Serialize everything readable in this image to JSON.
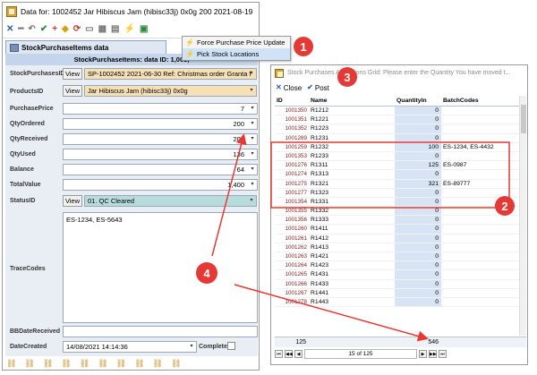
{
  "left_window": {
    "title": "Data for: 1002452 Jar Hibiscus Jam  (hibisc33j) 0x0g 200 2021-08-19",
    "tab_label": "StockPurchaseItems data",
    "form_header": "StockPurchaseItems: data ID: 1,003,",
    "fields": {
      "stock_purchases_id": {
        "label": "StockPurchasesID",
        "view": "View",
        "value": "SP-1002452 2021-06-30 Ref: Christmas order Granta f"
      },
      "products_id": {
        "label": "ProductsID",
        "view": "View",
        "value": "Jar Hibiscus Jam  (hibisc33j) 0x0g"
      },
      "purchase_price": {
        "label": "PurchasePrice",
        "value": "7"
      },
      "qty_ordered": {
        "label": "QtyOrdered",
        "value": "200"
      },
      "qty_received": {
        "label": "QtyReceived",
        "value": "200"
      },
      "qty_used": {
        "label": "QtyUsed",
        "value": "136"
      },
      "balance": {
        "label": "Balance",
        "value": "64"
      },
      "total_value": {
        "label": "TotalValue",
        "value": "1,400"
      },
      "status_id": {
        "label": "StatusID",
        "view": "View",
        "value": "01. QC Cleared"
      },
      "trace_codes": {
        "label": "TraceCodes",
        "value": "ES-1234, ES-5643"
      },
      "bb_date_received": {
        "label": "BBDateReceived",
        "value": ""
      },
      "date_created": {
        "label": "DateCreated",
        "value": "14/08/2021 14:14:36"
      },
      "complete": {
        "label": "Complete"
      }
    }
  },
  "popup_menu": {
    "items": [
      {
        "label": "Force Purchase Price Update"
      },
      {
        "label": "Pick Stock Locations"
      }
    ]
  },
  "right_window": {
    "title": "Stock Purchases Allocations  Grid: Please enter the Quantity You have moved t...",
    "close_label": "Close",
    "post_label": "Post",
    "columns": [
      "ID",
      "Name",
      "QuantityIn",
      "BatchCodes"
    ],
    "rows": [
      {
        "id": "1001350",
        "name": "R1212",
        "qty": "0",
        "batch": ""
      },
      {
        "id": "1001351",
        "name": "R1221",
        "qty": "0",
        "batch": ""
      },
      {
        "id": "1001352",
        "name": "R1223",
        "qty": "0",
        "batch": ""
      },
      {
        "id": "1001289",
        "name": "R1231",
        "qty": "0",
        "batch": ""
      },
      {
        "id": "1001259",
        "name": "R1232",
        "qty": "100",
        "batch": "ES-1234, ES-4432"
      },
      {
        "id": "1001353",
        "name": "R1233",
        "qty": "0",
        "batch": ""
      },
      {
        "id": "1001276",
        "name": "R1311",
        "qty": "125",
        "batch": "ES-0987"
      },
      {
        "id": "1001274",
        "name": "R1313",
        "qty": "0",
        "batch": ""
      },
      {
        "id": "1001275",
        "name": "R1321",
        "qty": "321",
        "batch": "ES-89777"
      },
      {
        "id": "1001277",
        "name": "R1323",
        "qty": "0",
        "batch": ""
      },
      {
        "id": "1001354",
        "name": "R1331",
        "qty": "0",
        "batch": ""
      },
      {
        "id": "1001355",
        "name": "R1332",
        "qty": "0",
        "batch": ""
      },
      {
        "id": "1001356",
        "name": "R1333",
        "qty": "0",
        "batch": ""
      },
      {
        "id": "1001260",
        "name": "R1411",
        "qty": "0",
        "batch": ""
      },
      {
        "id": "1001261",
        "name": "R1412",
        "qty": "0",
        "batch": ""
      },
      {
        "id": "1001262",
        "name": "R1413",
        "qty": "0",
        "batch": ""
      },
      {
        "id": "1001263",
        "name": "R1421",
        "qty": "0",
        "batch": ""
      },
      {
        "id": "1001264",
        "name": "R1423",
        "qty": "0",
        "batch": ""
      },
      {
        "id": "1001265",
        "name": "R1431",
        "qty": "0",
        "batch": ""
      },
      {
        "id": "1001266",
        "name": "R1433",
        "qty": "0",
        "batch": ""
      },
      {
        "id": "1001267",
        "name": "R1441",
        "qty": "0",
        "batch": ""
      },
      {
        "id": "1001278",
        "name": "R1443",
        "qty": "0",
        "batch": ""
      }
    ],
    "summary": {
      "count": "125",
      "qty_total": "546"
    },
    "nav_text": "15 of 125"
  },
  "annotations": {
    "badge_1": "1",
    "badge_2": "2",
    "badge_3": "3",
    "badge_4": "4",
    "accent_color": "#e53935"
  }
}
